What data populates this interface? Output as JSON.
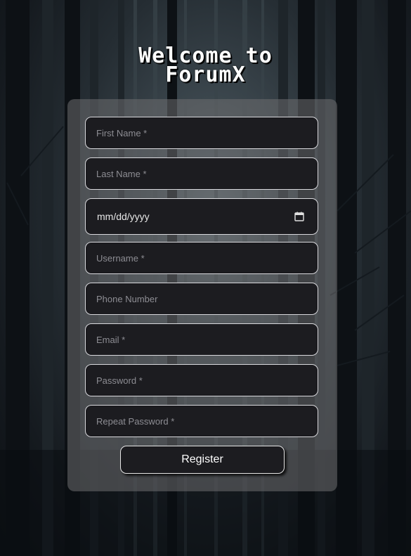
{
  "header": {
    "title_line1": "Welcome to",
    "title_line2": "ForumX"
  },
  "form": {
    "first_name_placeholder": "First Name *",
    "last_name_placeholder": "Last Name *",
    "date_placeholder": "mm/dd/yyyy",
    "username_placeholder": "Username *",
    "phone_placeholder": "Phone Number",
    "email_placeholder": "Email *",
    "password_placeholder": "Password *",
    "repeat_password_placeholder": "Repeat Password *",
    "register_label": "Register"
  },
  "icons": {
    "date": "calendar-icon"
  },
  "colors": {
    "card": "#6e6e70",
    "field_background": "#1c1c20",
    "field_border": "#d8d8dc",
    "placeholder_text": "#8d8d93",
    "text": "#ffffff"
  }
}
